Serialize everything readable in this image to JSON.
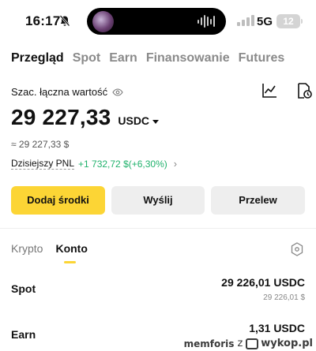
{
  "status_bar": {
    "time": "16:17",
    "network": "5G",
    "battery": "12"
  },
  "icons": {
    "bell": "bell-slash-icon",
    "eye": "eye-icon",
    "chart": "line-chart-icon",
    "history": "history-icon",
    "hexagon": "hexagon-settings-icon",
    "chevron": "chevron-right-icon"
  },
  "colors": {
    "accent": "#fcd535",
    "positive": "#20b26c",
    "secondary_button": "#eeeeee"
  },
  "tabs": [
    {
      "label": "Przegląd",
      "active": true
    },
    {
      "label": "Spot",
      "active": false
    },
    {
      "label": "Earn",
      "active": false
    },
    {
      "label": "Finansowanie",
      "active": false
    },
    {
      "label": "Futures",
      "active": false
    }
  ],
  "overview": {
    "label": "Szac. łączna wartość",
    "balance": "29 227,33",
    "currency": "USDC",
    "approx": "≈ 29 227,33 $",
    "pnl_label": "Dzisiejszy PNL",
    "pnl_value": "+1 732,72 $(+6,30%)"
  },
  "actions": {
    "deposit": "Dodaj środki",
    "send": "Wyślij",
    "transfer": "Przelew"
  },
  "subtabs": [
    {
      "label": "Krypto",
      "active": false
    },
    {
      "label": "Konto",
      "active": true
    }
  ],
  "accounts": [
    {
      "name": "Spot",
      "amount": "29 226,01 USDC",
      "fiat": "29 226,01 $"
    },
    {
      "name": "Earn",
      "amount": "1,31 USDC",
      "fiat": ""
    }
  ],
  "watermark": {
    "user": "memforis",
    "letter": "z",
    "site": "wykop.pl"
  }
}
